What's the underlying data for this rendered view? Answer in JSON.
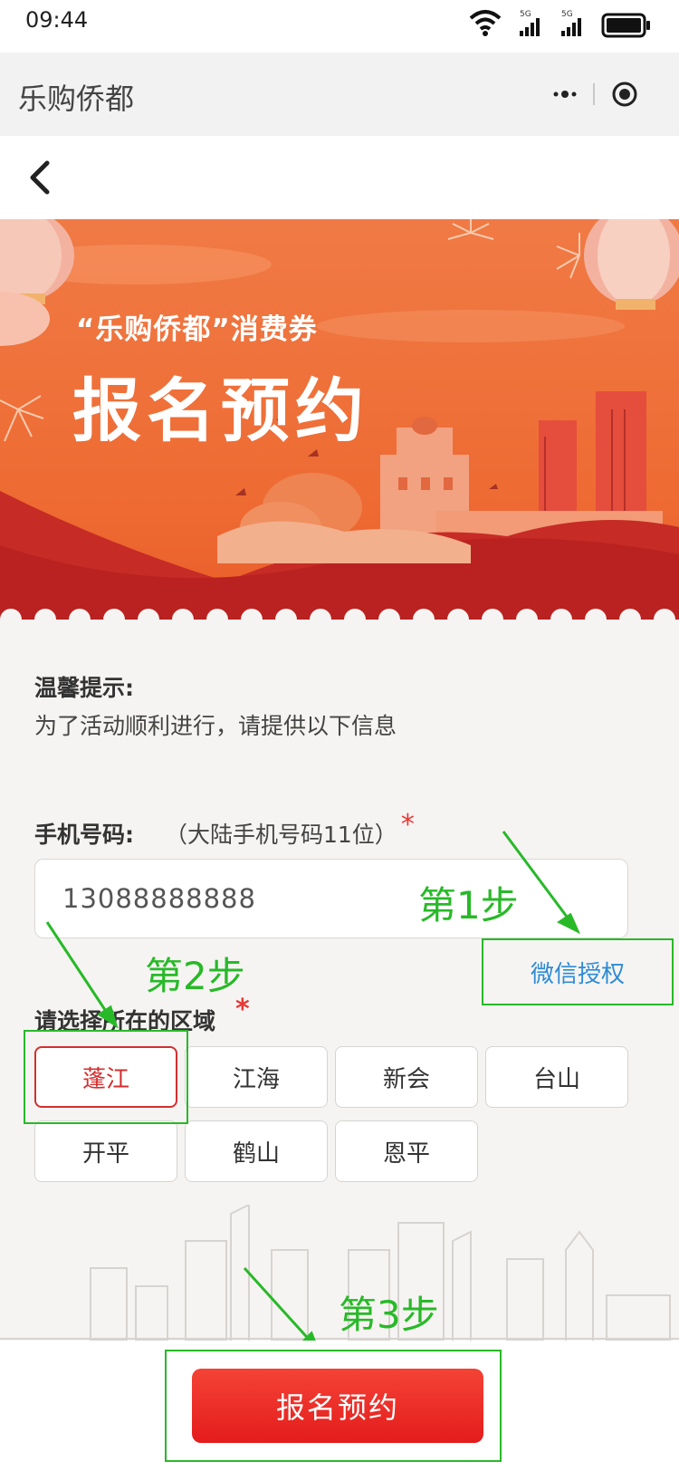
{
  "status_bar": {
    "time": "09:44",
    "network_label_1": "5G",
    "network_label_2": "5G"
  },
  "nav": {
    "title": "乐购侨都",
    "more_icon": "more-dots-icon",
    "close_icon": "target-circle-icon"
  },
  "back": {
    "icon": "chevron-left-icon"
  },
  "banner": {
    "subtitle": "“乐购侨都”消费券",
    "title": "报名预约"
  },
  "tip": {
    "title": "温馨提示:",
    "text": "为了活动顺利进行，请提供以下信息"
  },
  "phone": {
    "label": "手机号码:",
    "hint": "（大陆手机号码11位）",
    "required": "*",
    "value": "13088888888",
    "auth_button": "微信授权"
  },
  "region": {
    "label": "请选择所在的区域",
    "required": "*",
    "options": [
      "蓬江",
      "江海",
      "新会",
      "台山",
      "开平",
      "鹤山",
      "恩平"
    ],
    "selected": "蓬江"
  },
  "annotations": {
    "step1": "第1步",
    "step2": "第2步",
    "step3": "第3步"
  },
  "submit": {
    "label": "报名预约"
  },
  "colors": {
    "accent_red": "#e41c1c",
    "annotation_green": "#28b928",
    "link_blue": "#2e8bd6",
    "banner_orange": "#ef6a38"
  }
}
